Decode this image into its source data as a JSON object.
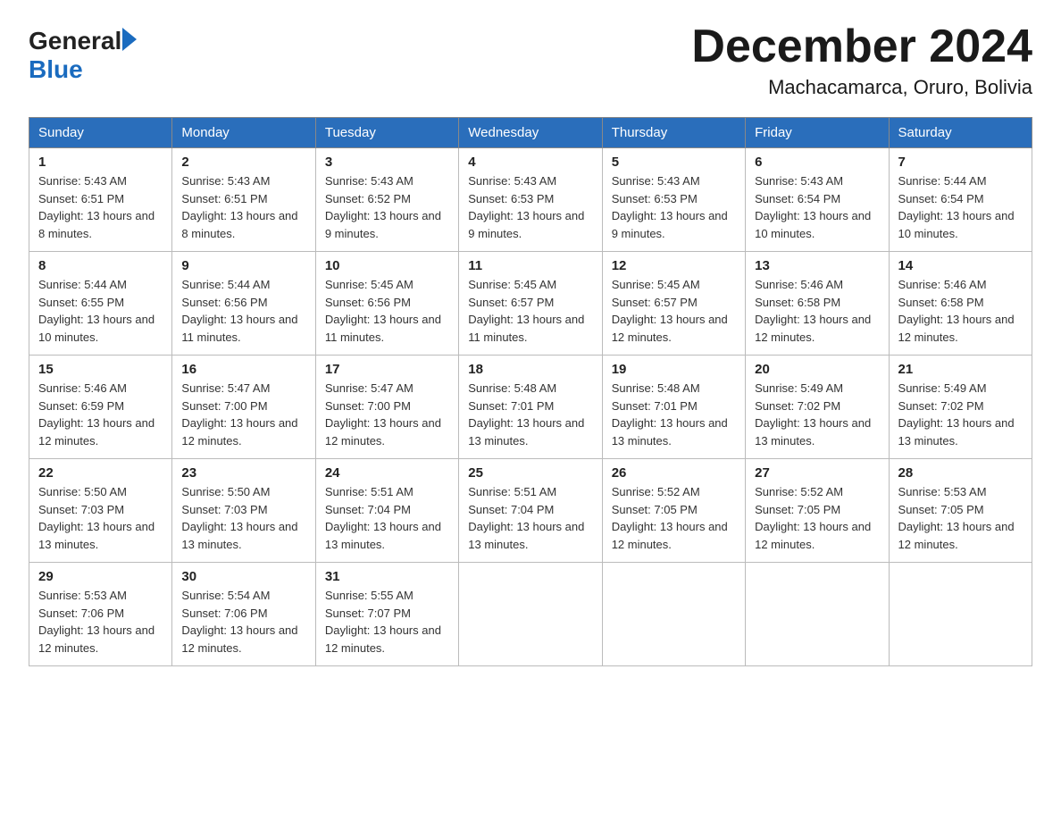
{
  "header": {
    "logo_general": "General",
    "logo_blue": "Blue",
    "month_title": "December 2024",
    "location": "Machacamarca, Oruro, Bolivia"
  },
  "weekdays": [
    "Sunday",
    "Monday",
    "Tuesday",
    "Wednesday",
    "Thursday",
    "Friday",
    "Saturday"
  ],
  "weeks": [
    [
      {
        "day": "1",
        "sunrise": "5:43 AM",
        "sunset": "6:51 PM",
        "daylight": "13 hours and 8 minutes."
      },
      {
        "day": "2",
        "sunrise": "5:43 AM",
        "sunset": "6:51 PM",
        "daylight": "13 hours and 8 minutes."
      },
      {
        "day": "3",
        "sunrise": "5:43 AM",
        "sunset": "6:52 PM",
        "daylight": "13 hours and 9 minutes."
      },
      {
        "day": "4",
        "sunrise": "5:43 AM",
        "sunset": "6:53 PM",
        "daylight": "13 hours and 9 minutes."
      },
      {
        "day": "5",
        "sunrise": "5:43 AM",
        "sunset": "6:53 PM",
        "daylight": "13 hours and 9 minutes."
      },
      {
        "day": "6",
        "sunrise": "5:43 AM",
        "sunset": "6:54 PM",
        "daylight": "13 hours and 10 minutes."
      },
      {
        "day": "7",
        "sunrise": "5:44 AM",
        "sunset": "6:54 PM",
        "daylight": "13 hours and 10 minutes."
      }
    ],
    [
      {
        "day": "8",
        "sunrise": "5:44 AM",
        "sunset": "6:55 PM",
        "daylight": "13 hours and 10 minutes."
      },
      {
        "day": "9",
        "sunrise": "5:44 AM",
        "sunset": "6:56 PM",
        "daylight": "13 hours and 11 minutes."
      },
      {
        "day": "10",
        "sunrise": "5:45 AM",
        "sunset": "6:56 PM",
        "daylight": "13 hours and 11 minutes."
      },
      {
        "day": "11",
        "sunrise": "5:45 AM",
        "sunset": "6:57 PM",
        "daylight": "13 hours and 11 minutes."
      },
      {
        "day": "12",
        "sunrise": "5:45 AM",
        "sunset": "6:57 PM",
        "daylight": "13 hours and 12 minutes."
      },
      {
        "day": "13",
        "sunrise": "5:46 AM",
        "sunset": "6:58 PM",
        "daylight": "13 hours and 12 minutes."
      },
      {
        "day": "14",
        "sunrise": "5:46 AM",
        "sunset": "6:58 PM",
        "daylight": "13 hours and 12 minutes."
      }
    ],
    [
      {
        "day": "15",
        "sunrise": "5:46 AM",
        "sunset": "6:59 PM",
        "daylight": "13 hours and 12 minutes."
      },
      {
        "day": "16",
        "sunrise": "5:47 AM",
        "sunset": "7:00 PM",
        "daylight": "13 hours and 12 minutes."
      },
      {
        "day": "17",
        "sunrise": "5:47 AM",
        "sunset": "7:00 PM",
        "daylight": "13 hours and 12 minutes."
      },
      {
        "day": "18",
        "sunrise": "5:48 AM",
        "sunset": "7:01 PM",
        "daylight": "13 hours and 13 minutes."
      },
      {
        "day": "19",
        "sunrise": "5:48 AM",
        "sunset": "7:01 PM",
        "daylight": "13 hours and 13 minutes."
      },
      {
        "day": "20",
        "sunrise": "5:49 AM",
        "sunset": "7:02 PM",
        "daylight": "13 hours and 13 minutes."
      },
      {
        "day": "21",
        "sunrise": "5:49 AM",
        "sunset": "7:02 PM",
        "daylight": "13 hours and 13 minutes."
      }
    ],
    [
      {
        "day": "22",
        "sunrise": "5:50 AM",
        "sunset": "7:03 PM",
        "daylight": "13 hours and 13 minutes."
      },
      {
        "day": "23",
        "sunrise": "5:50 AM",
        "sunset": "7:03 PM",
        "daylight": "13 hours and 13 minutes."
      },
      {
        "day": "24",
        "sunrise": "5:51 AM",
        "sunset": "7:04 PM",
        "daylight": "13 hours and 13 minutes."
      },
      {
        "day": "25",
        "sunrise": "5:51 AM",
        "sunset": "7:04 PM",
        "daylight": "13 hours and 13 minutes."
      },
      {
        "day": "26",
        "sunrise": "5:52 AM",
        "sunset": "7:05 PM",
        "daylight": "13 hours and 12 minutes."
      },
      {
        "day": "27",
        "sunrise": "5:52 AM",
        "sunset": "7:05 PM",
        "daylight": "13 hours and 12 minutes."
      },
      {
        "day": "28",
        "sunrise": "5:53 AM",
        "sunset": "7:05 PM",
        "daylight": "13 hours and 12 minutes."
      }
    ],
    [
      {
        "day": "29",
        "sunrise": "5:53 AM",
        "sunset": "7:06 PM",
        "daylight": "13 hours and 12 minutes."
      },
      {
        "day": "30",
        "sunrise": "5:54 AM",
        "sunset": "7:06 PM",
        "daylight": "13 hours and 12 minutes."
      },
      {
        "day": "31",
        "sunrise": "5:55 AM",
        "sunset": "7:07 PM",
        "daylight": "13 hours and 12 minutes."
      },
      null,
      null,
      null,
      null
    ]
  ],
  "labels": {
    "sunrise_prefix": "Sunrise: ",
    "sunset_prefix": "Sunset: ",
    "daylight_prefix": "Daylight: "
  }
}
